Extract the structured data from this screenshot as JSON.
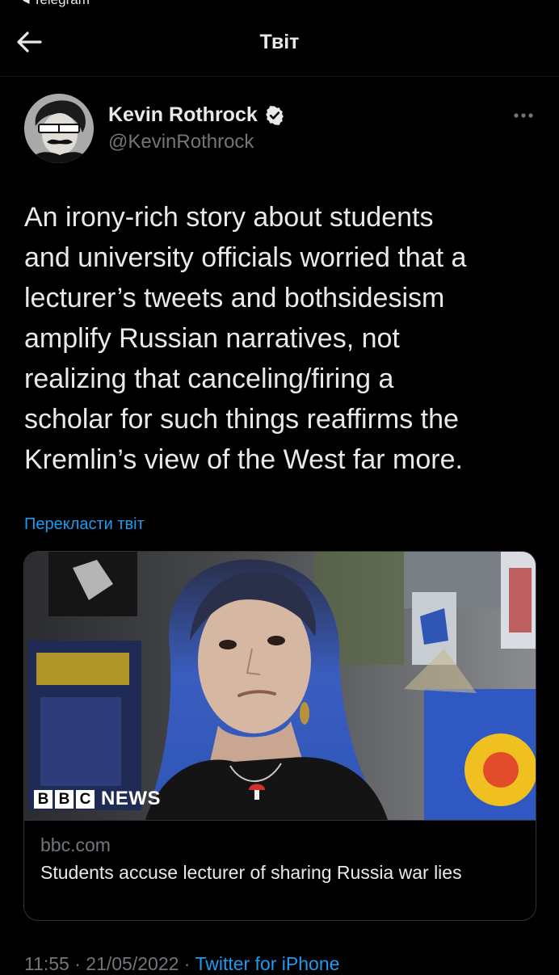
{
  "status_bar": {
    "back_app_label": "◂ Telegram"
  },
  "header": {
    "title": "Твіт"
  },
  "tweet": {
    "author": {
      "name": "Kevin Rothrock",
      "handle": "@KevinRothrock",
      "verified": true
    },
    "text": "An irony-rich story about students\nand university officials worried that a\nlecturer’s tweets and bothsidesism\namplify Russian narratives, not\nrealizing that canceling/firing a\nscholar for such things reaffirms the\nKremlin’s view of the West far more.",
    "translate_label": "Перекласти твіт",
    "card": {
      "source_logo_letters": [
        "B",
        "B",
        "C"
      ],
      "source_logo_word": "NEWS",
      "domain": "bbc.com",
      "title": "Students accuse lecturer of sharing Russia war lies"
    },
    "timestamp": "11:55 · 21/05/2022",
    "separator": " · ",
    "client": "Twitter for iPhone"
  },
  "colors": {
    "background": "#000000",
    "text_primary": "#e7e9ea",
    "text_secondary": "#71767b",
    "accent": "#1d9bf0",
    "border": "#2f3336"
  },
  "icons": {
    "back": "arrow-left-icon",
    "verified": "verified-badge-icon",
    "more": "more-horizontal-icon"
  }
}
